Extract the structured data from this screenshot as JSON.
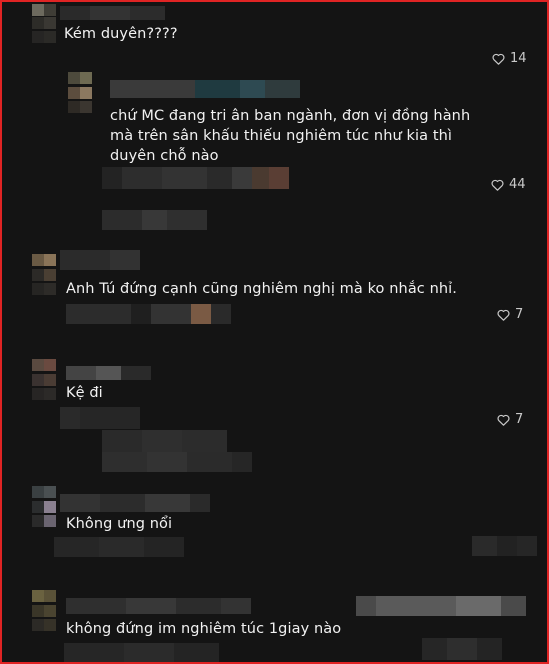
{
  "comments": [
    {
      "text": "Kém duyên????",
      "likes": "14"
    },
    {
      "text": "chứ MC đang tri ân ban ngành, đơn vị đồng hành mà trên sân khấu thiếu nghiêm túc như kia thì duyên chỗ nào",
      "likes": "44"
    },
    {
      "text": "Anh Tú đứng cạnh cũng nghiêm nghị mà ko nhắc nhỉ.",
      "likes": "7"
    },
    {
      "text": "Kệ đi",
      "likes": "7"
    },
    {
      "text": "Không ưng nổi"
    },
    {
      "text": "không đứng im nghiêm túc 1giay nào"
    }
  ],
  "icons": {
    "like": "heart-outline-icon"
  },
  "colors": {
    "frame_border": "#e02424",
    "background": "#141414",
    "text": "#f2f2f2",
    "muted": "#c9c9c9"
  }
}
